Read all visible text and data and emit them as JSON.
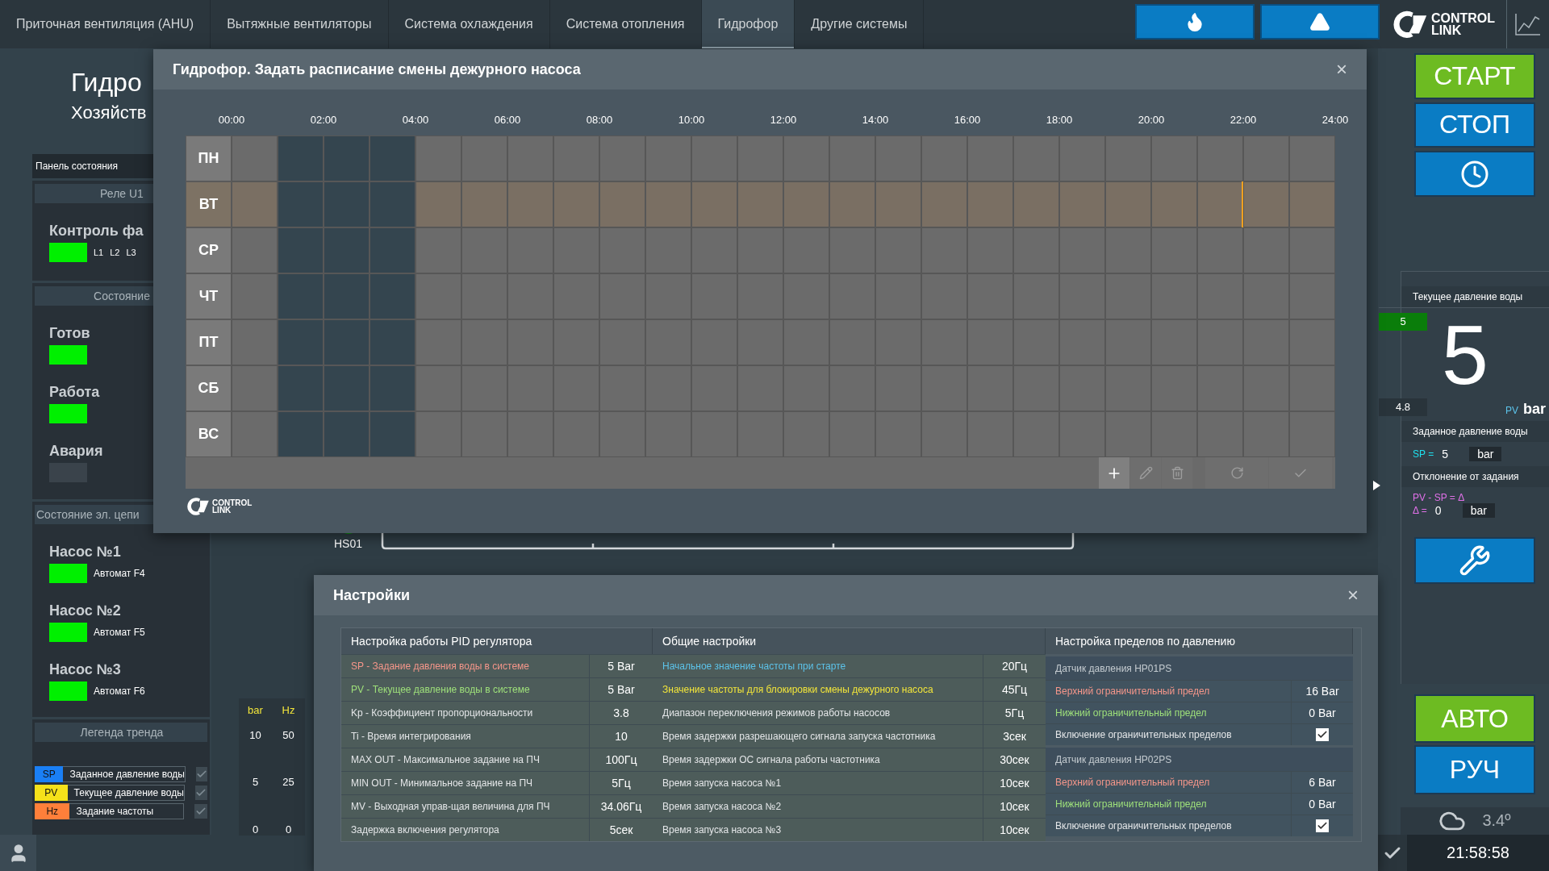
{
  "nav": {
    "tabs": [
      {
        "label": "Приточная вентиляция (AHU)",
        "selected": false
      },
      {
        "label": "Вытяжные вентиляторы",
        "selected": false
      },
      {
        "label": "Система охлаждения",
        "selected": false
      },
      {
        "label": "Система отопления",
        "selected": false
      },
      {
        "label": "Гидрофор",
        "selected": true
      },
      {
        "label": "Другие системы",
        "selected": false
      }
    ],
    "alarm_buttons": [
      {
        "kind": "fire"
      },
      {
        "kind": "warning"
      }
    ],
    "logo": {
      "line1": "CONTROL",
      "line2": "LINK"
    }
  },
  "page": {
    "title": "Гидро",
    "subtitle": "Хозяйств"
  },
  "status_panel": {
    "title": "Панель состояния",
    "sections": [
      {
        "header": "Реле U1",
        "items": [
          {
            "kind": "phase",
            "label": "Контроль фа",
            "on": true,
            "phases": [
              "L1",
              "L2",
              "L3"
            ]
          }
        ]
      },
      {
        "header": "Состояние",
        "items": [
          {
            "kind": "lamp",
            "label": "Готов",
            "on": true
          },
          {
            "kind": "lamp",
            "label": "Работа",
            "on": true
          },
          {
            "kind": "lamp",
            "label": "Авария",
            "on": false
          }
        ]
      },
      {
        "header": "Состояние эл. цепи",
        "items": [
          {
            "kind": "breaker",
            "label": "Насос №1",
            "on": true,
            "note": "Автомат F4"
          },
          {
            "kind": "breaker",
            "label": "Насос №2",
            "on": true,
            "note": "Автомат F5"
          },
          {
            "kind": "breaker",
            "label": "Насос №3",
            "on": true,
            "note": "Автомат F6"
          }
        ]
      }
    ]
  },
  "trend_legend": {
    "header": "Легенда тренда",
    "items": [
      {
        "tag": "SP",
        "label": "Заданное давление воды",
        "color": "#1a7ff5",
        "checked": true
      },
      {
        "tag": "PV",
        "label": "Текущее давление воды",
        "color": "#f5e11a",
        "checked": true
      },
      {
        "tag": "Hz",
        "label": "Задание частоты",
        "color": "#ff7f3a",
        "checked": true
      }
    ]
  },
  "trend_axes": {
    "units": [
      "bar",
      "Hz"
    ],
    "ticks": [
      [
        "10",
        "50"
      ],
      [
        "5",
        "25"
      ],
      [
        "0",
        "0"
      ]
    ]
  },
  "process": {
    "label": "HS01"
  },
  "schedule_dialog": {
    "title": "Гидрофор. Задать расписание смены дежурного насоса",
    "close_label": "×",
    "hours": [
      "00:00",
      "02:00",
      "04:00",
      "06:00",
      "08:00",
      "10:00",
      "12:00",
      "14:00",
      "16:00",
      "18:00",
      "20:00",
      "22:00",
      "24:00"
    ],
    "days": [
      {
        "label": "ПН",
        "selected": false,
        "on_hours": [
          false,
          true,
          true,
          true,
          false,
          false,
          false,
          false,
          false,
          false,
          false,
          false,
          false,
          false,
          false,
          false,
          false,
          false,
          false,
          false,
          false,
          false,
          false,
          false
        ]
      },
      {
        "label": "ВТ",
        "selected": true,
        "on_hours": [
          false,
          true,
          true,
          true,
          false,
          false,
          false,
          false,
          false,
          false,
          false,
          false,
          false,
          false,
          false,
          false,
          false,
          false,
          false,
          false,
          false,
          false,
          false,
          false
        ]
      },
      {
        "label": "СР",
        "selected": false,
        "on_hours": [
          false,
          true,
          true,
          true,
          false,
          false,
          false,
          false,
          false,
          false,
          false,
          false,
          false,
          false,
          false,
          false,
          false,
          false,
          false,
          false,
          false,
          false,
          false,
          false
        ]
      },
      {
        "label": "ЧТ",
        "selected": false,
        "on_hours": [
          false,
          true,
          true,
          true,
          false,
          false,
          false,
          false,
          false,
          false,
          false,
          false,
          false,
          false,
          false,
          false,
          false,
          false,
          false,
          false,
          false,
          false,
          false,
          false
        ]
      },
      {
        "label": "ПТ",
        "selected": false,
        "on_hours": [
          false,
          true,
          true,
          true,
          false,
          false,
          false,
          false,
          false,
          false,
          false,
          false,
          false,
          false,
          false,
          false,
          false,
          false,
          false,
          false,
          false,
          false,
          false,
          false
        ]
      },
      {
        "label": "СБ",
        "selected": false,
        "on_hours": [
          false,
          true,
          true,
          true,
          false,
          false,
          false,
          false,
          false,
          false,
          false,
          false,
          false,
          false,
          false,
          false,
          false,
          false,
          false,
          false,
          false,
          false,
          false,
          false
        ]
      },
      {
        "label": "ВС",
        "selected": false,
        "on_hours": [
          false,
          true,
          true,
          true,
          false,
          false,
          false,
          false,
          false,
          false,
          false,
          false,
          false,
          false,
          false,
          false,
          false,
          false,
          false,
          false,
          false,
          false,
          false,
          false
        ]
      }
    ],
    "now_marker": {
      "level": 0.915
    },
    "toolbar": [
      {
        "kind": "add",
        "disabled": false
      },
      {
        "kind": "edit",
        "disabled": true
      },
      {
        "kind": "delete",
        "disabled": true
      },
      {
        "kind": "undo",
        "disabled": true
      },
      {
        "kind": "apply",
        "disabled": true
      }
    ],
    "logo": {
      "line1": "CONTROL",
      "line2": "LINK"
    }
  },
  "settings_dialog": {
    "title": "Настройки",
    "close_label": "×",
    "pid": {
      "header": "Настройка работы PID регулятора",
      "rows": [
        {
          "kind": "setpoint",
          "name": "SP - Задание давления воды в системе",
          "value": "5 Bar"
        },
        {
          "kind": "actual",
          "name": "PV - Текущее давление воды в системе",
          "value": "5 Bar"
        },
        {
          "kind": "plain",
          "name": "Kp - Коэффициент пропорциональности",
          "value": "3.8"
        },
        {
          "kind": "plain",
          "name": "Ti - Время интегрирования",
          "value": "10"
        },
        {
          "kind": "plain",
          "name": "MAX OUT - Максимальное задание на ПЧ",
          "value": "100Гц"
        },
        {
          "kind": "plain",
          "name": "MIN OUT - Минимальное задание на ПЧ",
          "value": "5Гц"
        },
        {
          "kind": "plain",
          "name": "MV - Выходная управ-щая величина для ПЧ",
          "value": "34.06Гц"
        },
        {
          "kind": "plain",
          "name": "Задержка включения регулятора",
          "value": "5сек"
        }
      ]
    },
    "general": {
      "header": "Общие настройки",
      "rows": [
        {
          "kind": "info",
          "name": "Начальное значение частоты при старте",
          "value": "20Гц"
        },
        {
          "kind": "warn",
          "name": "Значение частоты для блокировки смены дежурного насоса",
          "value": "45Гц"
        },
        {
          "kind": "plain",
          "name": "Диапазон переключения режимов работы насосов",
          "value": "5Гц"
        },
        {
          "kind": "plain",
          "name": "Время задержки разрешающего сигнала запуска частотника",
          "value": "3сек"
        },
        {
          "kind": "plain",
          "name": "Время задержки ОС сигнала работы частотника",
          "value": "30сек"
        },
        {
          "kind": "plain",
          "name": "Время запуска насоса №1",
          "value": "10сек"
        },
        {
          "kind": "plain",
          "name": "Время запуска насоса №2",
          "value": "10сек"
        },
        {
          "kind": "plain",
          "name": "Время запуска насоса №3",
          "value": "10сек"
        }
      ]
    },
    "limits": {
      "header": "Настройка пределов по давлению",
      "sensors": [
        {
          "name": "Датчик давления HP01PS",
          "rows": [
            {
              "kind": "upper",
              "name": "Верхний ограничительный предел",
              "value": "16 Bar"
            },
            {
              "kind": "lower",
              "name": "Нижний ограничительный предел",
              "value": "0 Bar"
            },
            {
              "kind": "toggle",
              "name": "Включение ограничительных пределов",
              "checked": true
            }
          ]
        },
        {
          "name": "Датчик давления HP02PS",
          "rows": [
            {
              "kind": "upper",
              "name": "Верхний ограничительный предел",
              "value": "6 Bar"
            },
            {
              "kind": "lower",
              "name": "Нижний ограничительный предел",
              "value": "0 Bar"
            },
            {
              "kind": "toggle",
              "name": "Включение ограничительных пределов",
              "checked": true
            }
          ]
        }
      ]
    }
  },
  "right_panel": {
    "buttons": [
      {
        "kind": "start",
        "label": "СТАРТ"
      },
      {
        "kind": "stop",
        "label": "СТОП"
      },
      {
        "kind": "schedule"
      }
    ],
    "pressure": {
      "title": "Текущее давление воды",
      "value": "5",
      "high": "5",
      "low": "4.8",
      "tag": "PV",
      "unit": "bar"
    },
    "setpoint": {
      "title": "Заданное давление воды",
      "tag": "SP =",
      "value": "5",
      "unit": "bar"
    },
    "deviation": {
      "title": "Отклонение от задания",
      "formula": "PV - SP = Δ",
      "tag": "Δ =",
      "value": "0",
      "unit": "bar"
    },
    "mode_buttons": [
      {
        "kind": "auto",
        "label": "АВТО"
      },
      {
        "kind": "manual",
        "label": "РУЧ"
      }
    ],
    "weather": {
      "temperature": "3.4º"
    },
    "clock": "21:58:58"
  }
}
